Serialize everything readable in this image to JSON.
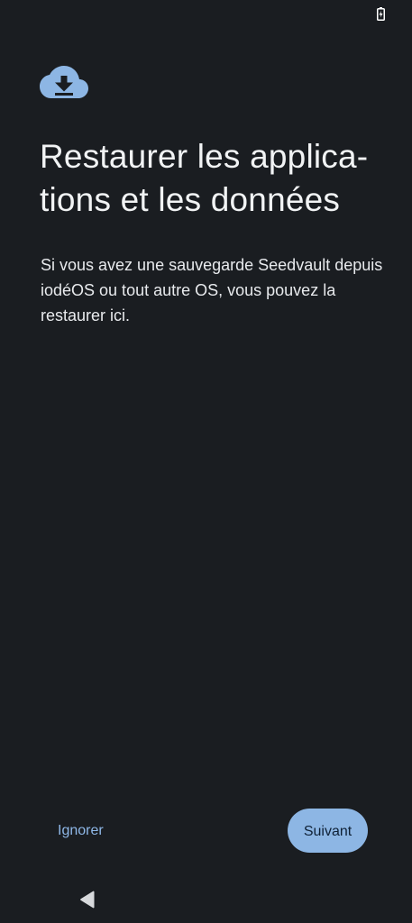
{
  "screen": {
    "title": "Restaurer les applica­tions et les données",
    "description": "Si vous avez une sauvegarde Seedvault depuis iodéOS ou tout autre OS, vous pouvez la restaurer ici."
  },
  "actions": {
    "skip_label": "Ignorer",
    "next_label": "Suivant"
  },
  "icons": {
    "header": "cloud-download-icon",
    "status": "battery-charging-icon",
    "nav": "back-icon"
  },
  "colors": {
    "background": "#1a1d21",
    "accent": "#8db6e4",
    "link": "#8fb8e8"
  }
}
